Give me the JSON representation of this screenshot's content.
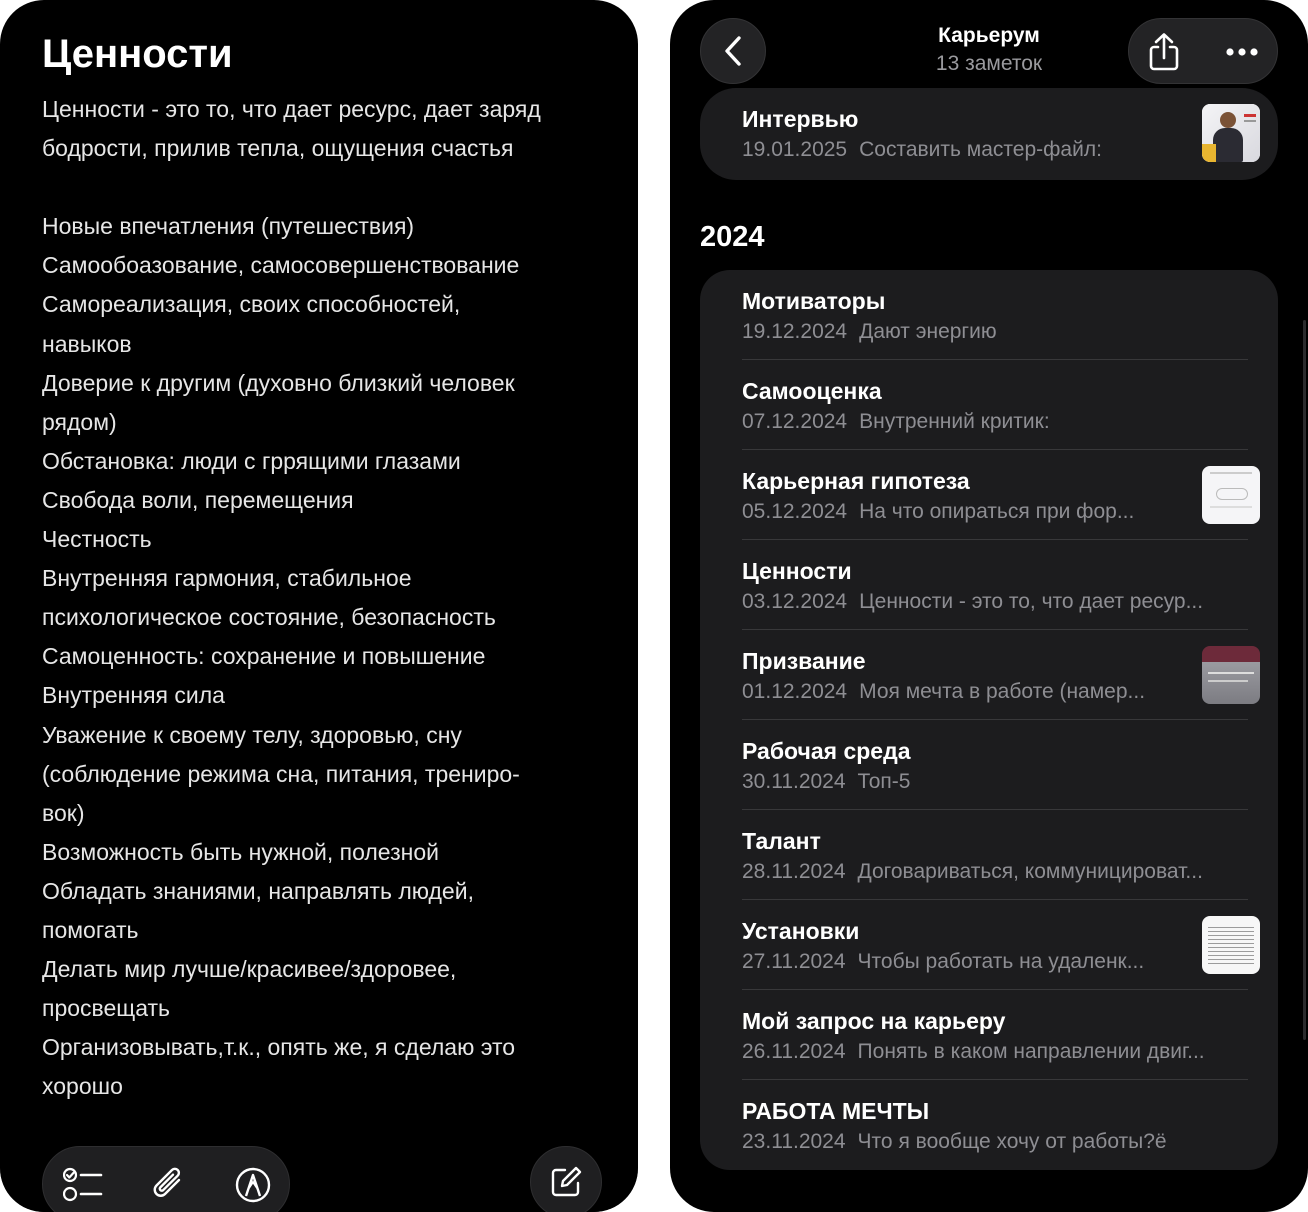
{
  "note": {
    "title": "Ценности",
    "intro": "Ценности - это то, что дает ресурс, дает заряд бодрости, прилив тепла, ощущения счастья",
    "lines": [
      "Новые впечатления (путешествия)",
      "Самообоазование, самосовершенствование",
      "Самореализация, своих способностей,",
      "навыков",
      "Доверие к другим (духовно близкий человек",
      "рядом)",
      "Обстановка: люди с гррящими глазами",
      "Свобода воли, перемещения",
      "Честность",
      "Внутренняя гармония, стабильное",
      "психологическое состояние, безопасность",
      "Самоценность: сохранение и повышение",
      "Внутренняя сила",
      "Уважение к своему телу, здоровью, сну",
      "(соблюдение режима сна, питания, трениро-",
      "вок)",
      "Возможность быть нужной, полезной",
      "Обладать знаниями, направлять людей,",
      "помогать",
      "Делать мир лучше/красивее/здоровее,",
      "просвещать",
      "Организовывать,т.к., опять же, я сделаю это",
      "хорошо"
    ],
    "toolbar_icons": [
      "checklist-icon",
      "paperclip-icon",
      "markup-icon"
    ],
    "compose_icon": "compose-icon"
  },
  "folder": {
    "title": "Карьерум",
    "subtitle": "13 заметок",
    "back_icon": "chevron-left-icon",
    "share_icon": "share-icon",
    "more_icon": "ellipsis-icon",
    "top_note": {
      "title": "Интервью",
      "date": "19.01.2025",
      "preview": "Составить мастер-файл:",
      "thumbnail": "photo"
    },
    "year": "2024",
    "notes": [
      {
        "title": "Мотиваторы",
        "date": "19.12.2024",
        "preview": "Дают энергию",
        "thumbnail": ""
      },
      {
        "title": "Самооценка",
        "date": "07.12.2024",
        "preview": "Внутренний критик:",
        "thumbnail": ""
      },
      {
        "title": "Карьерная гипотеза",
        "date": "05.12.2024",
        "preview": "На что опираться при фор...",
        "thumbnail": "sketch"
      },
      {
        "title": "Ценности",
        "date": "03.12.2024",
        "preview": "Ценности - это то, что дает ресур...",
        "thumbnail": ""
      },
      {
        "title": "Призвание",
        "date": "01.12.2024",
        "preview": "Моя мечта в работе (намер...",
        "thumbnail": "slide"
      },
      {
        "title": "Рабочая среда",
        "date": "30.11.2024",
        "preview": "Топ-5",
        "thumbnail": ""
      },
      {
        "title": "Талант",
        "date": "28.11.2024",
        "preview": "Договариваться, коммуницироват...",
        "thumbnail": ""
      },
      {
        "title": "Установки",
        "date": "27.11.2024",
        "preview": "Чтобы работать на удаленк...",
        "thumbnail": "document"
      },
      {
        "title": "Мой запрос на карьеру",
        "date": "26.11.2024",
        "preview": "Понять в каком направлении двиг...",
        "thumbnail": ""
      },
      {
        "title": "РАБОТА МЕЧТЫ",
        "date": "23.11.2024",
        "preview": "Что я вообще хочу от работы?ё",
        "thumbnail": ""
      }
    ]
  }
}
